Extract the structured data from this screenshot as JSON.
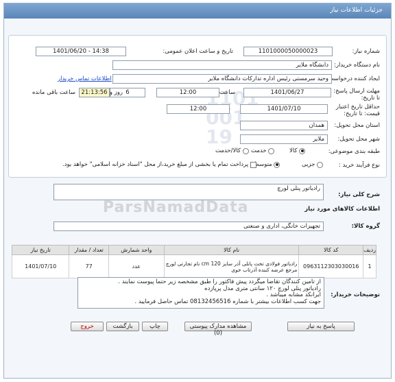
{
  "header": {
    "title": "جزئیات اطلاعات نیاز"
  },
  "form": {
    "need_number_label": "شماره نیاز:",
    "need_number": "1101000050000023",
    "announce_label": "تاریخ و ساعت اعلان عمومی:",
    "announce_value": "1401/06/20 - 14:38",
    "buyer_org_label": "نام دستگاه خریدار:",
    "buyer_org": "دانشگاه ملایر",
    "creator_label": "ایجاد کننده درخواست:",
    "creator": "وحید سرمستی رئیس اداره تدارکات دانشگاه ملایر",
    "contact_link": "اطلاعات تماس خریدار",
    "deadline_label": "مهلت ارسال پاسخ: تا تاریخ:",
    "deadline_date": "1401/06/27",
    "time_label": "ساعت",
    "deadline_time": "12:00",
    "days_value": "6",
    "days_label": "روز و",
    "remaining_value": "21:13:56",
    "remaining_label": "ساعت باقی مانده",
    "validity_label": "حداقل تاریخ اعتبار قیمت: تا تاریخ:",
    "validity_date": "1401/07/10",
    "validity_time": "12:00",
    "province_label": "استان محل تحویل:",
    "province": "همدان",
    "city_label": "شهر محل تحویل:",
    "city": "ملایر",
    "category_label": "طبقه بندی موضوعی:",
    "category_options": [
      "کالا",
      "خدمت",
      "کالا/خدمت"
    ],
    "process_label": "نوع فرآیند خرید :",
    "process_options": [
      "جزیی",
      "متوسط"
    ],
    "payment_note": "پرداخت تمام یا بخشی از مبلغ خرید،از محل \"اسناد خزانه اسلامی\" خواهد بود."
  },
  "need_summary": {
    "label": "شرح کلی نیاز:",
    "value": "رادیاتور پنلی لورچ"
  },
  "goods": {
    "section_title": "اطلاعات کالاهای مورد نیاز",
    "group_label": "گروه کالا:",
    "group_value": "تجهیزات خانگی، اداری و صنعتی",
    "columns": [
      "ردیف",
      "کد کالا",
      "نام کالا",
      "واحد شمارش",
      "تعداد / مقدار",
      "تاریخ نیاز"
    ],
    "rows": [
      {
        "row": "1",
        "code": "0963112303030016",
        "name_line1": "رادیاتور فولادی تخت پانلی آذر سایز 120 cm نام تجارتی لورچ",
        "name_line2": "مرجع عرضه کننده آذرتاب خوی",
        "unit": "عدد",
        "qty": "77",
        "date": "1401/07/10"
      }
    ]
  },
  "buyer_desc": {
    "label": "توضیحات خریدار:",
    "lines": [
      "از تامین کنندگان تقاضا میگردد پیش فاکتور را طبق مشخصه زیر حتما پیوست نمایند .",
      "رادیاتور پنلی لورچ ۱۲۰ سانتی متری مدل پرپازده",
      "ایرانکد مشابه میباشد .",
      "جهت کسب اطلاعات بیشتر با شماره  08132456516 تماس حاصل فرمایید ."
    ]
  },
  "buttons": {
    "reply": "پاسخ به نیاز",
    "attachments": "مشاهده مدارک پیوستی (0)",
    "print": "چاپ",
    "back": "بازگشت",
    "exit": "خروج"
  },
  "watermark": {
    "text": "ParsNamadData"
  }
}
